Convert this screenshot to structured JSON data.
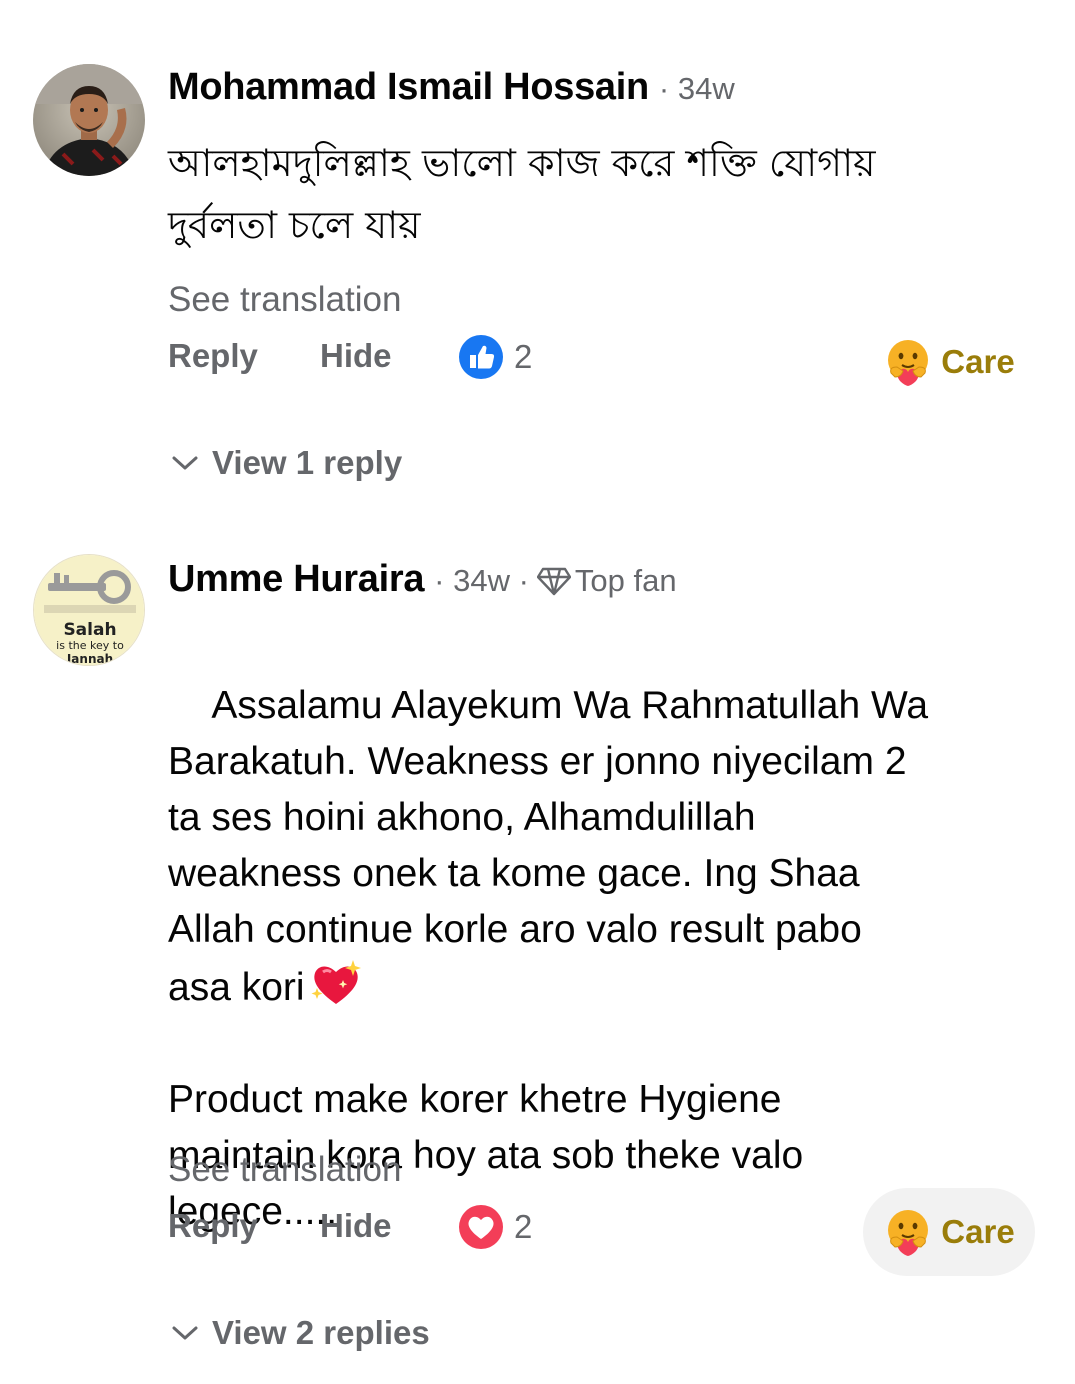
{
  "comments": [
    {
      "author": "Mohammad Ismail Hossain",
      "time": "· 34w",
      "text": "আলহামদুলিল্লাহ ভালো কাজ করে শক্তি যোগায়\nদুর্বলতা চলে যায়",
      "see_translation": "See translation",
      "reply_label": "Reply",
      "hide_label": "Hide",
      "reaction_icon": "like-icon",
      "reaction_count": "2",
      "care_label": "Care",
      "view_replies": "View 1 reply"
    },
    {
      "author": "Umme Huraira",
      "time": "· 34w ·",
      "badge": "Top fan",
      "text": "Assalamu Alayekum Wa Rahmatullah Wa\nBarakatuh. Weakness er jonno niyecilam 2\nta ses hoini akhono, Alhamdulillah\nweakness onek ta kome gace. Ing Shaa\nAllah continue korle aro valo result pabo\nasa kori",
      "text_continued": "Product make korer khetre Hygiene\nmaintain kora hoy ata sob theke valo\nlegece.....",
      "see_translation": "See translation",
      "reply_label": "Reply",
      "hide_label": "Hide",
      "reaction_icon": "love-icon",
      "reaction_count": "2",
      "care_label": "Care",
      "view_replies": "View 2 replies",
      "avatar_text": {
        "line1": "Salah",
        "line2": "is the key to",
        "line3": "Jannah"
      }
    }
  ],
  "colors": {
    "like_blue": "#1877f2",
    "love_red": "#f33e58",
    "care_label": "#9a7d0a",
    "secondary_text": "#65676b"
  }
}
